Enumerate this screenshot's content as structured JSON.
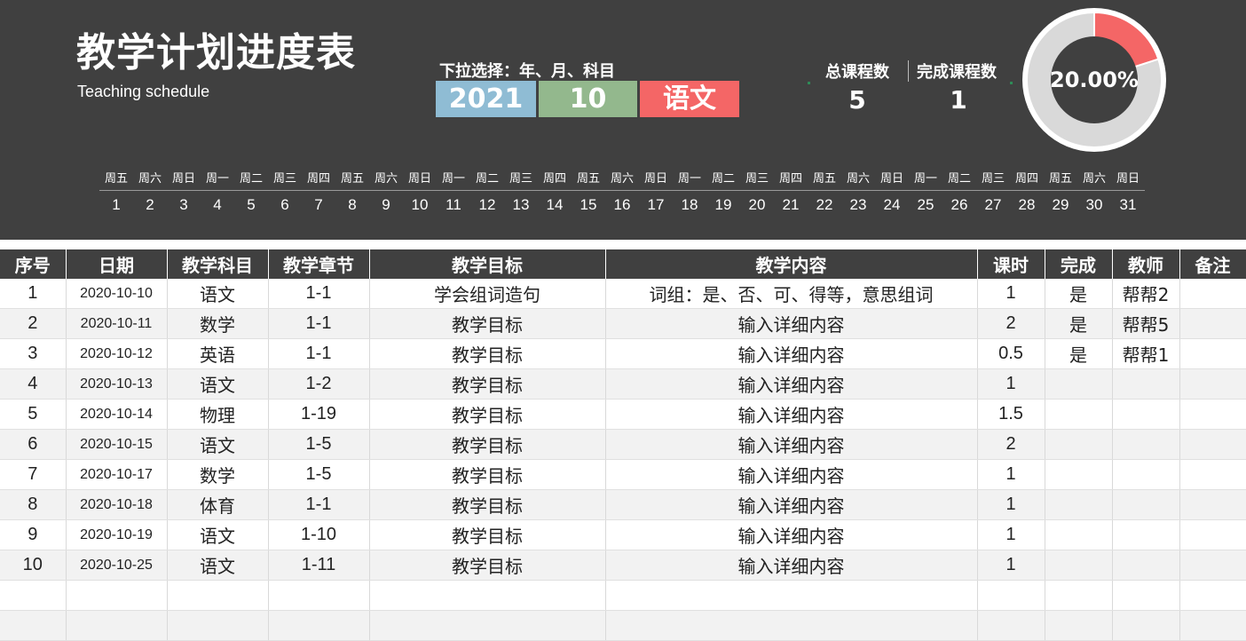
{
  "header": {
    "title": "教学计划进度表",
    "subtitle": "Teaching schedule",
    "dropdown_label": "下拉选择：年、月、科目",
    "year": "2021",
    "month": "10",
    "subject": "语文",
    "colors": {
      "background": "#404040",
      "year": "#8fbcd4",
      "month": "#93b88d",
      "subject": "#f46666",
      "donut_done": "#f46666",
      "donut_rest": "#d9d9d9"
    },
    "total_label": "总课程数",
    "total_value": "5",
    "done_label": "完成课程数",
    "done_value": "1",
    "completion_text": "20.00%",
    "completion_fraction": 0.2
  },
  "calendar": {
    "days": [
      {
        "wk": "周五",
        "d": "1"
      },
      {
        "wk": "周六",
        "d": "2"
      },
      {
        "wk": "周日",
        "d": "3"
      },
      {
        "wk": "周一",
        "d": "4"
      },
      {
        "wk": "周二",
        "d": "5"
      },
      {
        "wk": "周三",
        "d": "6"
      },
      {
        "wk": "周四",
        "d": "7"
      },
      {
        "wk": "周五",
        "d": "8"
      },
      {
        "wk": "周六",
        "d": "9"
      },
      {
        "wk": "周日",
        "d": "10"
      },
      {
        "wk": "周一",
        "d": "11"
      },
      {
        "wk": "周二",
        "d": "12"
      },
      {
        "wk": "周三",
        "d": "13"
      },
      {
        "wk": "周四",
        "d": "14"
      },
      {
        "wk": "周五",
        "d": "15"
      },
      {
        "wk": "周六",
        "d": "16"
      },
      {
        "wk": "周日",
        "d": "17"
      },
      {
        "wk": "周一",
        "d": "18"
      },
      {
        "wk": "周二",
        "d": "19"
      },
      {
        "wk": "周三",
        "d": "20"
      },
      {
        "wk": "周四",
        "d": "21"
      },
      {
        "wk": "周五",
        "d": "22"
      },
      {
        "wk": "周六",
        "d": "23"
      },
      {
        "wk": "周日",
        "d": "24"
      },
      {
        "wk": "周一",
        "d": "25"
      },
      {
        "wk": "周二",
        "d": "26"
      },
      {
        "wk": "周三",
        "d": "27"
      },
      {
        "wk": "周四",
        "d": "28"
      },
      {
        "wk": "周五",
        "d": "29"
      },
      {
        "wk": "周六",
        "d": "30"
      },
      {
        "wk": "周日",
        "d": "31"
      }
    ]
  },
  "table": {
    "columns": [
      "序号",
      "日期",
      "教学科目",
      "教学章节",
      "教学目标",
      "教学内容",
      "课时",
      "完成",
      "教师",
      "备注"
    ],
    "rows": [
      [
        "1",
        "2020-10-10",
        "语文",
        "1-1",
        "学会组词造句",
        "词组：是、否、可、得等，意思组词",
        "1",
        "是",
        "帮帮2",
        ""
      ],
      [
        "2",
        "2020-10-11",
        "数学",
        "1-1",
        "教学目标",
        "输入详细内容",
        "2",
        "是",
        "帮帮5",
        ""
      ],
      [
        "3",
        "2020-10-12",
        "英语",
        "1-1",
        "教学目标",
        "输入详细内容",
        "0.5",
        "是",
        "帮帮1",
        ""
      ],
      [
        "4",
        "2020-10-13",
        "语文",
        "1-2",
        "教学目标",
        "输入详细内容",
        "1",
        "",
        "",
        ""
      ],
      [
        "5",
        "2020-10-14",
        "物理",
        "1-19",
        "教学目标",
        "输入详细内容",
        "1.5",
        "",
        "",
        ""
      ],
      [
        "6",
        "2020-10-15",
        "语文",
        "1-5",
        "教学目标",
        "输入详细内容",
        "2",
        "",
        "",
        ""
      ],
      [
        "7",
        "2020-10-17",
        "数学",
        "1-5",
        "教学目标",
        "输入详细内容",
        "1",
        "",
        "",
        ""
      ],
      [
        "8",
        "2020-10-18",
        "体育",
        "1-1",
        "教学目标",
        "输入详细内容",
        "1",
        "",
        "",
        ""
      ],
      [
        "9",
        "2020-10-19",
        "语文",
        "1-10",
        "教学目标",
        "输入详细内容",
        "1",
        "",
        "",
        ""
      ],
      [
        "10",
        "2020-10-25",
        "语文",
        "1-11",
        "教学目标",
        "输入详细内容",
        "1",
        "",
        "",
        ""
      ],
      [
        "",
        "",
        "",
        "",
        "",
        "",
        "",
        "",
        "",
        ""
      ],
      [
        "",
        "",
        "",
        "",
        "",
        "",
        "",
        "",
        "",
        ""
      ]
    ]
  }
}
